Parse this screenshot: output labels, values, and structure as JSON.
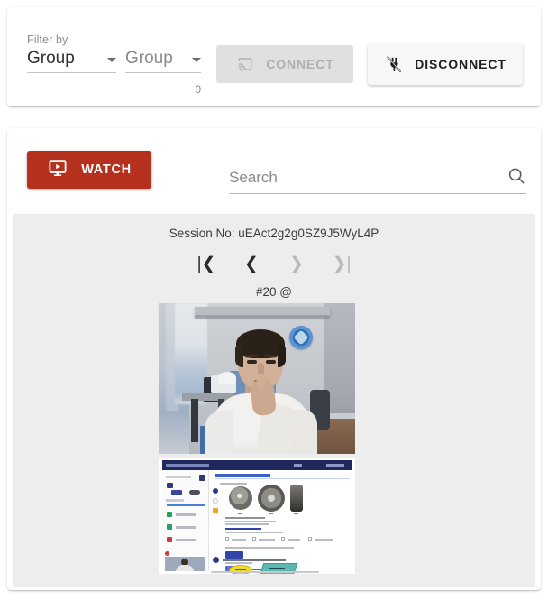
{
  "filter_bar": {
    "label": "Filter by",
    "selects": [
      {
        "name": "group-primary",
        "value": "Group",
        "placeholder": "Group",
        "selected": true
      },
      {
        "name": "group-secondary",
        "value": "Group",
        "placeholder": "Group",
        "selected": false
      }
    ],
    "count_hint": "0",
    "connect_button": {
      "label": "CONNECT",
      "icon": "cast-icon",
      "disabled": true
    },
    "disconnect_button": {
      "label": "DISCONNECT",
      "icon": "cast-off-icon",
      "disabled": false
    }
  },
  "session_card": {
    "watch_button": {
      "label": "WATCH",
      "icon": "monitor-play-icon",
      "color": "#b5311d"
    },
    "search": {
      "value": "",
      "placeholder": "Search",
      "icon": "search-icon"
    },
    "session_number_label": "Session No: uEAct2g2g0SZ9J5WyL4P",
    "frame_caption": "#20 @",
    "pager": [
      {
        "name": "first",
        "glyph": "|❮",
        "enabled": true
      },
      {
        "name": "previous",
        "glyph": "❮",
        "enabled": true
      },
      {
        "name": "next",
        "glyph": "❯",
        "enabled": false
      },
      {
        "name": "last",
        "glyph": "❯|",
        "enabled": false
      }
    ],
    "media": {
      "webcam": {
        "name": "webcam-snapshot",
        "alt": "Webcam photo of a person seated in a room"
      },
      "screenshot": {
        "name": "screen-capture-snapshot",
        "alt": "Captured browser screen showing an online exam page with images, answer options and a flowchart"
      }
    }
  },
  "colors": {
    "accent_red": "#b5311d",
    "panel_gray": "#ededed",
    "disabled_gray": "#e0e0e0",
    "card_white": "#ffffff"
  }
}
